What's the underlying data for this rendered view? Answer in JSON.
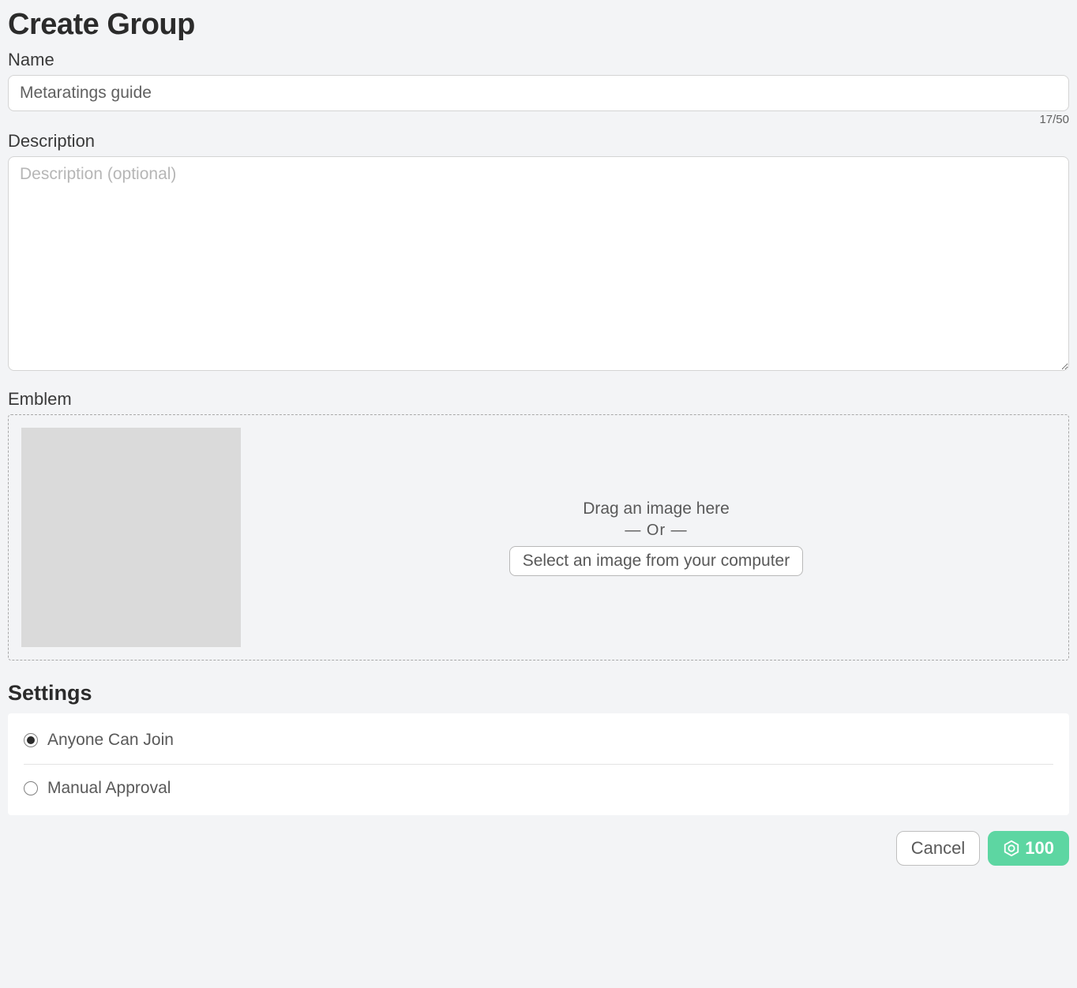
{
  "page": {
    "title": "Create Group"
  },
  "name": {
    "label": "Name",
    "value": "Metaratings guide",
    "counter": "17/50"
  },
  "description": {
    "label": "Description",
    "value": "",
    "placeholder": "Description (optional)"
  },
  "emblem": {
    "label": "Emblem",
    "drag_text": "Drag an image here",
    "or_text": "— Or —",
    "select_button": "Select an image from your computer"
  },
  "settings": {
    "heading": "Settings",
    "options": [
      {
        "label": "Anyone Can Join",
        "selected": true
      },
      {
        "label": "Manual Approval",
        "selected": false
      }
    ]
  },
  "footer": {
    "cancel_label": "Cancel",
    "cost": "100"
  },
  "colors": {
    "accent": "#5dd6a2",
    "background": "#f3f4f6"
  }
}
